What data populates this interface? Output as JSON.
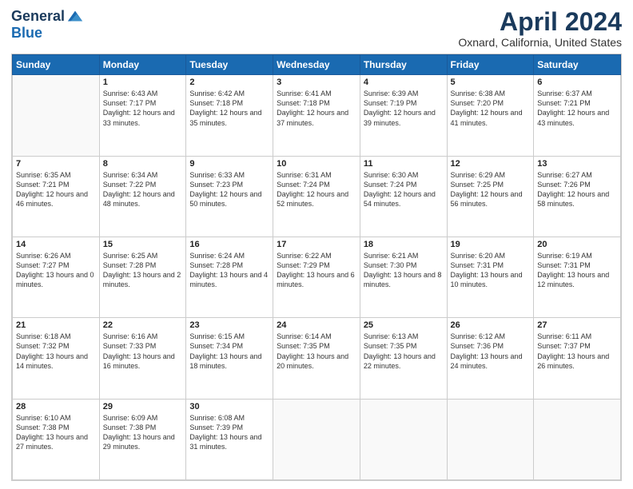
{
  "header": {
    "logo_line1": "General",
    "logo_line2": "Blue",
    "title": "April 2024",
    "subtitle": "Oxnard, California, United States"
  },
  "days_header": [
    "Sunday",
    "Monday",
    "Tuesday",
    "Wednesday",
    "Thursday",
    "Friday",
    "Saturday"
  ],
  "weeks": [
    [
      {
        "day": "",
        "sunrise": "",
        "sunset": "",
        "daylight": ""
      },
      {
        "day": "1",
        "sunrise": "6:43 AM",
        "sunset": "7:17 PM",
        "daylight": "12 hours and 33 minutes."
      },
      {
        "day": "2",
        "sunrise": "6:42 AM",
        "sunset": "7:18 PM",
        "daylight": "12 hours and 35 minutes."
      },
      {
        "day": "3",
        "sunrise": "6:41 AM",
        "sunset": "7:18 PM",
        "daylight": "12 hours and 37 minutes."
      },
      {
        "day": "4",
        "sunrise": "6:39 AM",
        "sunset": "7:19 PM",
        "daylight": "12 hours and 39 minutes."
      },
      {
        "day": "5",
        "sunrise": "6:38 AM",
        "sunset": "7:20 PM",
        "daylight": "12 hours and 41 minutes."
      },
      {
        "day": "6",
        "sunrise": "6:37 AM",
        "sunset": "7:21 PM",
        "daylight": "12 hours and 43 minutes."
      }
    ],
    [
      {
        "day": "7",
        "sunrise": "6:35 AM",
        "sunset": "7:21 PM",
        "daylight": "12 hours and 46 minutes."
      },
      {
        "day": "8",
        "sunrise": "6:34 AM",
        "sunset": "7:22 PM",
        "daylight": "12 hours and 48 minutes."
      },
      {
        "day": "9",
        "sunrise": "6:33 AM",
        "sunset": "7:23 PM",
        "daylight": "12 hours and 50 minutes."
      },
      {
        "day": "10",
        "sunrise": "6:31 AM",
        "sunset": "7:24 PM",
        "daylight": "12 hours and 52 minutes."
      },
      {
        "day": "11",
        "sunrise": "6:30 AM",
        "sunset": "7:24 PM",
        "daylight": "12 hours and 54 minutes."
      },
      {
        "day": "12",
        "sunrise": "6:29 AM",
        "sunset": "7:25 PM",
        "daylight": "12 hours and 56 minutes."
      },
      {
        "day": "13",
        "sunrise": "6:27 AM",
        "sunset": "7:26 PM",
        "daylight": "12 hours and 58 minutes."
      }
    ],
    [
      {
        "day": "14",
        "sunrise": "6:26 AM",
        "sunset": "7:27 PM",
        "daylight": "13 hours and 0 minutes."
      },
      {
        "day": "15",
        "sunrise": "6:25 AM",
        "sunset": "7:28 PM",
        "daylight": "13 hours and 2 minutes."
      },
      {
        "day": "16",
        "sunrise": "6:24 AM",
        "sunset": "7:28 PM",
        "daylight": "13 hours and 4 minutes."
      },
      {
        "day": "17",
        "sunrise": "6:22 AM",
        "sunset": "7:29 PM",
        "daylight": "13 hours and 6 minutes."
      },
      {
        "day": "18",
        "sunrise": "6:21 AM",
        "sunset": "7:30 PM",
        "daylight": "13 hours and 8 minutes."
      },
      {
        "day": "19",
        "sunrise": "6:20 AM",
        "sunset": "7:31 PM",
        "daylight": "13 hours and 10 minutes."
      },
      {
        "day": "20",
        "sunrise": "6:19 AM",
        "sunset": "7:31 PM",
        "daylight": "13 hours and 12 minutes."
      }
    ],
    [
      {
        "day": "21",
        "sunrise": "6:18 AM",
        "sunset": "7:32 PM",
        "daylight": "13 hours and 14 minutes."
      },
      {
        "day": "22",
        "sunrise": "6:16 AM",
        "sunset": "7:33 PM",
        "daylight": "13 hours and 16 minutes."
      },
      {
        "day": "23",
        "sunrise": "6:15 AM",
        "sunset": "7:34 PM",
        "daylight": "13 hours and 18 minutes."
      },
      {
        "day": "24",
        "sunrise": "6:14 AM",
        "sunset": "7:35 PM",
        "daylight": "13 hours and 20 minutes."
      },
      {
        "day": "25",
        "sunrise": "6:13 AM",
        "sunset": "7:35 PM",
        "daylight": "13 hours and 22 minutes."
      },
      {
        "day": "26",
        "sunrise": "6:12 AM",
        "sunset": "7:36 PM",
        "daylight": "13 hours and 24 minutes."
      },
      {
        "day": "27",
        "sunrise": "6:11 AM",
        "sunset": "7:37 PM",
        "daylight": "13 hours and 26 minutes."
      }
    ],
    [
      {
        "day": "28",
        "sunrise": "6:10 AM",
        "sunset": "7:38 PM",
        "daylight": "13 hours and 27 minutes."
      },
      {
        "day": "29",
        "sunrise": "6:09 AM",
        "sunset": "7:38 PM",
        "daylight": "13 hours and 29 minutes."
      },
      {
        "day": "30",
        "sunrise": "6:08 AM",
        "sunset": "7:39 PM",
        "daylight": "13 hours and 31 minutes."
      },
      {
        "day": "",
        "sunrise": "",
        "sunset": "",
        "daylight": ""
      },
      {
        "day": "",
        "sunrise": "",
        "sunset": "",
        "daylight": ""
      },
      {
        "day": "",
        "sunrise": "",
        "sunset": "",
        "daylight": ""
      },
      {
        "day": "",
        "sunrise": "",
        "sunset": "",
        "daylight": ""
      }
    ]
  ],
  "labels": {
    "sunrise": "Sunrise:",
    "sunset": "Sunset:",
    "daylight": "Daylight:"
  }
}
